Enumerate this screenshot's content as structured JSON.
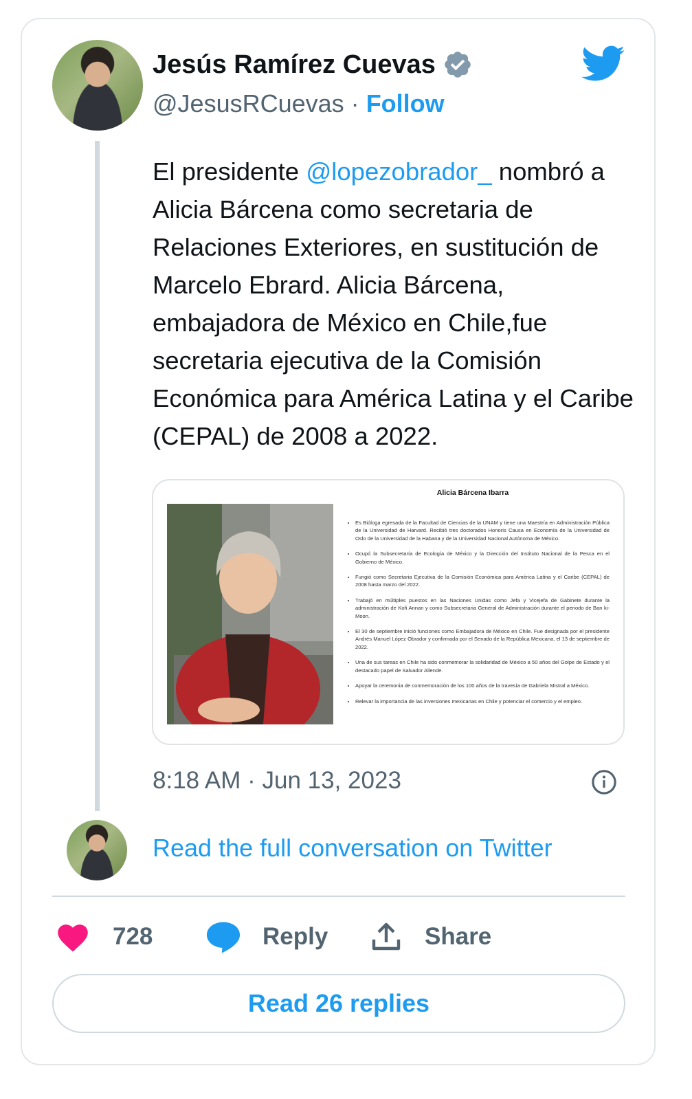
{
  "author": {
    "name": "Jesús Ramírez Cuevas",
    "handle": "@JesusRCuevas",
    "separator": "·",
    "follow_label": "Follow",
    "verified_icon": "verified-badge-icon"
  },
  "tweet": {
    "text_before": "El presidente ",
    "mention": "@lopezobrador_",
    "text_after": " nombró a Alicia Bárcena como secretaria de Relaciones Exteriores, en sustitución de Marcelo Ebrard. Alicia Bárcena, embajadora de México en Chile,fue secretaria ejecutiva de la Comisión Económica para América Latina y el Caribe (CEPAL) de 2008 a 2022.",
    "timestamp": "8:18 AM · Jun 13, 2023"
  },
  "media": {
    "doc_title": "Alicia Bárcena Ibarra",
    "bullets": [
      "Es Bióloga egresada de la Facultad de Ciencias de la UNAM y tiene una Maestría en Administración Pública de la Universidad de Harvard. Recibió tres doctorados Honoris Causa en Economía de la Universidad de Oslo de la Universidad de la Habana y de la Universidad Nacional Autónoma de México.",
      "Ocupó la Subsecretaría de Ecología de México y la Dirección del Instituto Nacional de la Pesca en el Gobierno de México.",
      "Fungió como Secretaria Ejecutiva de la Comisión Económica para América Latina y el Caribe (CEPAL) de 2008 hasta marzo del 2022.",
      "Trabajó en múltiples puestos en las Naciones Unidas como Jefa y Vicejefa de Gabinete durante la administración de Kofi Annan y como Subsecretaria General de Administración durante el periodo de Ban ki-Moon.",
      "El 30 de septiembre inició funciones como Embajadora de México en Chile. Fue designada por el presidente Andrés Manuel López Obrador y confirmada por el Senado de la República Mexicana, el 13 de septiembre de 2022.",
      "Una de sus tareas en Chile ha sido conmemorar la solidaridad de México a 50 años del Golpe de Estado y el destacado papel de Salvador Allende.",
      "Apoyar la ceremonia de conmemoración de los 100 años de la travesía de Gabriela Mistral a México.",
      "Relevar la importancia de las inversiones mexicanas en Chile y potenciar el comercio y el empleo."
    ]
  },
  "links": {
    "read_full": "Read the full conversation on Twitter",
    "read_replies": "Read 26 replies"
  },
  "actions": {
    "likes": "728",
    "reply_label": "Reply",
    "share_label": "Share"
  },
  "colors": {
    "accent": "#1d9bf0",
    "heart": "#f91880",
    "muted": "#536471"
  }
}
